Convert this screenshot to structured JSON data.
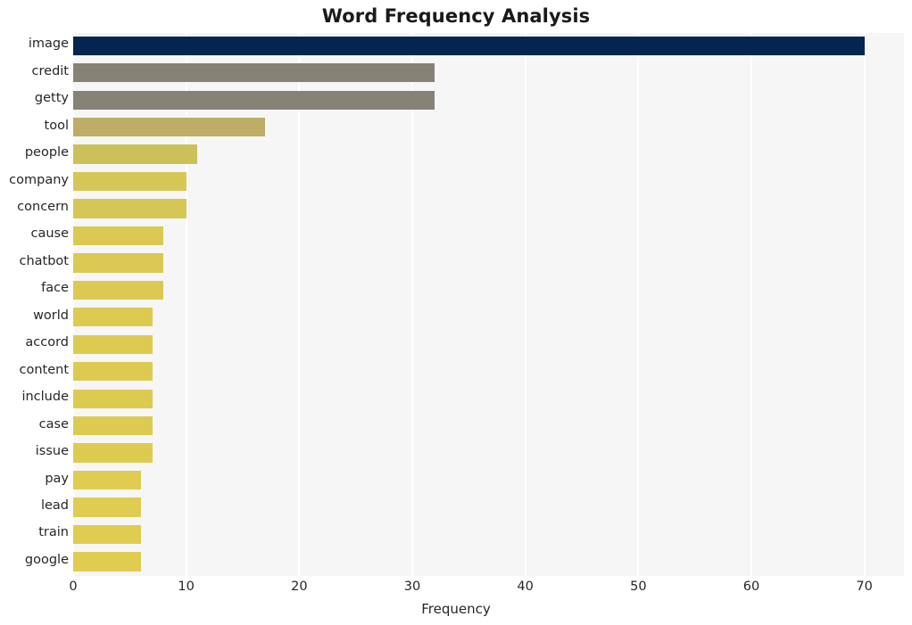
{
  "chart_data": {
    "type": "bar",
    "orientation": "horizontal",
    "title": "Word Frequency Analysis",
    "xlabel": "Frequency",
    "ylabel": "",
    "xlim": [
      0,
      73.5
    ],
    "xticks": [
      0,
      10,
      20,
      30,
      40,
      50,
      60,
      70
    ],
    "xtick_labels": [
      "0",
      "10",
      "20",
      "30",
      "40",
      "50",
      "60",
      "70"
    ],
    "grid": "vertical-white-on-light-gray",
    "legend": "none",
    "categories": [
      "image",
      "credit",
      "getty",
      "tool",
      "people",
      "company",
      "concern",
      "cause",
      "chatbot",
      "face",
      "world",
      "accord",
      "content",
      "include",
      "case",
      "issue",
      "pay",
      "lead",
      "train",
      "google"
    ],
    "values": [
      70,
      32,
      32,
      17,
      11,
      10,
      10,
      8,
      8,
      8,
      7,
      7,
      7,
      7,
      7,
      7,
      6,
      6,
      6,
      6
    ],
    "bar_colors": [
      "#04254f",
      "#868376",
      "#868376",
      "#bdad66",
      "#ccc159",
      "#d6c655",
      "#d6c655",
      "#dbc952",
      "#dbc952",
      "#dbc952",
      "#ddcb51",
      "#ddcb51",
      "#ddcb51",
      "#ddcb51",
      "#ddcb51",
      "#ddcb51",
      "#e0cc50",
      "#e0cc50",
      "#e0cc50",
      "#e0cc50"
    ]
  },
  "style": {
    "plot_background": "#f6f6f7",
    "figure_background": "#ffffff",
    "gridline_color": "#ffffff",
    "text_color": "#262626",
    "title_color": "#1a1a1a"
  }
}
